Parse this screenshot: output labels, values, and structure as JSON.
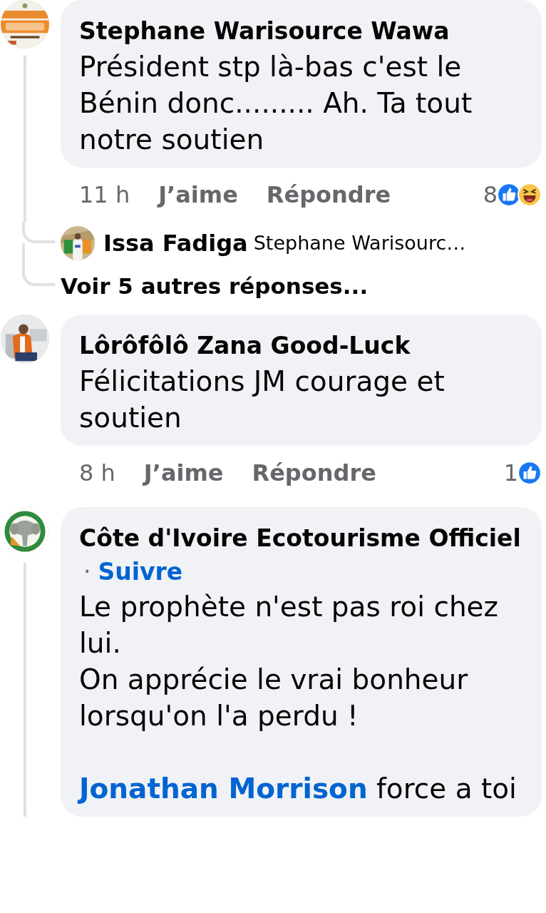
{
  "comments": [
    {
      "avatar": {
        "kind": "picture"
      },
      "author": "Stephane Warisource Wawa",
      "body": [
        {
          "kind": "text",
          "text": "Président stp là-bas c'est le Bénin donc......... Ah. Ta tout notre soutien"
        }
      ],
      "time": "11 h",
      "like_label": "J’aime",
      "reply_label": "Répondre",
      "reaction_count": "8",
      "reactions": [
        {
          "kind": "like"
        },
        {
          "kind": "haha"
        }
      ],
      "replies": [
        {
          "avatar": {
            "kind": "picture"
          },
          "author": "Issa Fadiga",
          "preview": "Stephane Warisourc…"
        }
      ],
      "more_replies": "Voir 5 autres réponses..."
    },
    {
      "avatar": {
        "kind": "picture"
      },
      "author": "Lôrôfôlô Zana Good-Luck",
      "body": [
        {
          "kind": "text",
          "text": "Félicitations JM courage et soutien"
        }
      ],
      "time": "8 h",
      "like_label": "J’aime",
      "reply_label": "Répondre",
      "reaction_count": "1",
      "reactions": [
        {
          "kind": "like"
        }
      ]
    },
    {
      "avatar": {
        "kind": "picture"
      },
      "author": "Côte d'Ivoire Ecotourisme Officiel",
      "follow": {
        "separator": "·",
        "label": "Suivre"
      },
      "body": [
        {
          "kind": "text",
          "text": "Le prophète n'est pas roi chez lui."
        },
        {
          "kind": "text",
          "text": "On apprécie le vrai bonheur lorsqu'on l'a perdu !"
        },
        {
          "kind": "blank"
        },
        {
          "kind": "mixed",
          "parts": [
            {
              "kind": "mention",
              "text": "Jonathan Morrison"
            },
            {
              "kind": "text",
              "text": " force a toi"
            }
          ]
        }
      ],
      "thread_continues": true
    }
  ]
}
